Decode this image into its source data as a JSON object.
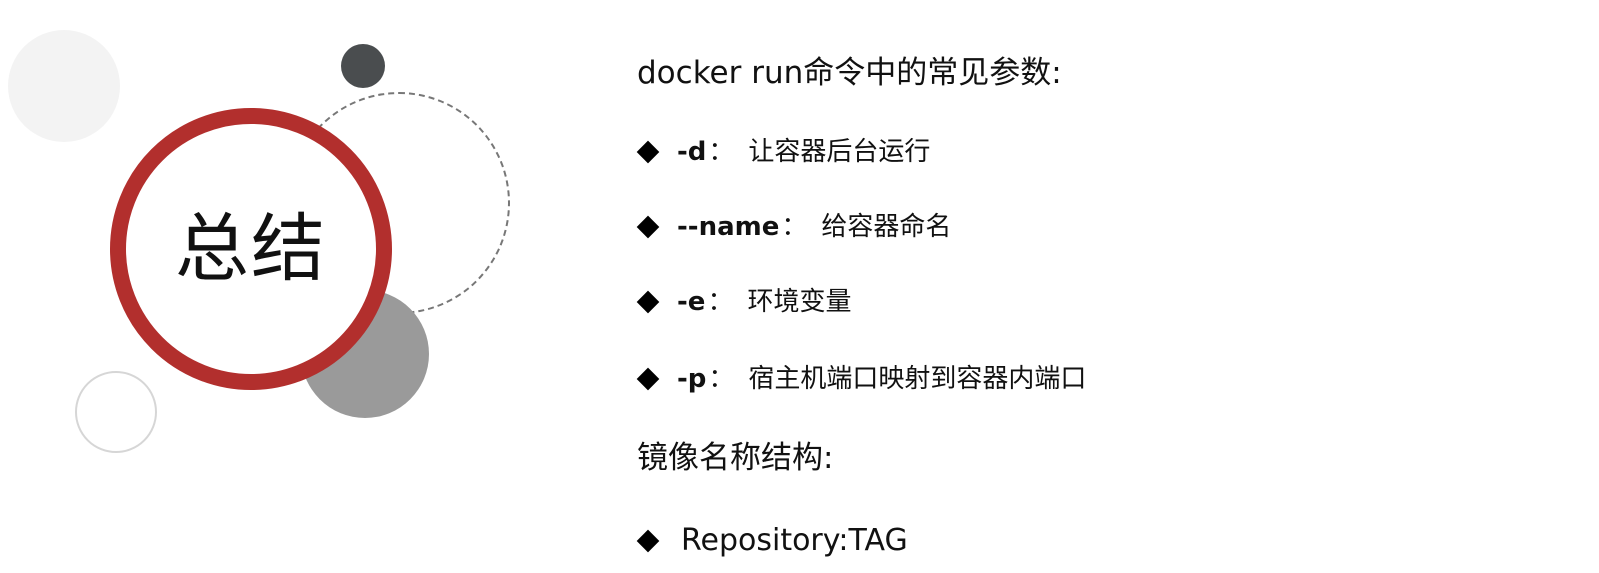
{
  "title": "总结",
  "section1": {
    "heading": "docker run命令中的常见参数:",
    "items": [
      {
        "param": "-d",
        "sep": "：",
        "desc": "让容器后台运行"
      },
      {
        "param": "--name",
        "sep": "：",
        "desc": "给容器命名"
      },
      {
        "param": "-e",
        "sep": "：",
        "desc": "环境变量"
      },
      {
        "param": "-p",
        "sep": "：",
        "desc": "宿主机端口映射到容器内端口"
      }
    ]
  },
  "section2": {
    "heading": "镜像名称结构:",
    "items": [
      {
        "text": "Repository:TAG"
      }
    ]
  },
  "colors": {
    "accent_ring": "#b22f2d",
    "dark_circle": "#4a4d4f",
    "gray_circle": "#9a9a9a",
    "light_circle": "#f3f3f3",
    "text": "#111111"
  },
  "icons": {
    "bullet": "diamond-bullet-icon"
  }
}
